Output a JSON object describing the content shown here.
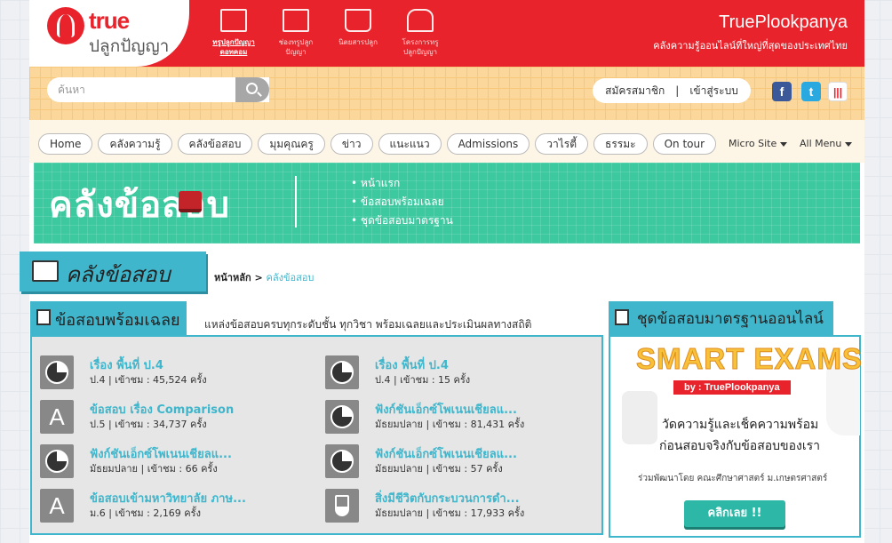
{
  "header": {
    "logo_word": "true",
    "logo_thai": "ปลูกปัญญา",
    "brand_title": "TruePlookpanya",
    "brand_subtitle": "คลังความรู้ออนไลน์ที่ใหญ่ที่สุดของประเทศไทย",
    "nav": [
      {
        "label_1": "ทรูปลูกปัญญา",
        "label_2": "ดอทคอม",
        "icon": "monitor-icon"
      },
      {
        "label_1": "ช่องทรูปลูก",
        "label_2": "ปัญญา",
        "icon": "tv-icon"
      },
      {
        "label_1": "นิตยสารปลูก",
        "label_2": "",
        "icon": "book-icon"
      },
      {
        "label_1": "โครงการทรู",
        "label_2": "ปลูกปัญญา",
        "icon": "school-icon"
      }
    ]
  },
  "search": {
    "placeholder": "ค้นหา",
    "register": "สมัครสมาชิก",
    "divider": "|",
    "login": "เข้าสู่ระบบ",
    "social": {
      "facebook": "f",
      "twitter": "t",
      "stats": "|||"
    }
  },
  "menu": {
    "items": [
      "Home",
      "คลังความรู้",
      "คลังข้อสอบ",
      "มุมคุณครู",
      "ข่าว",
      "แนะแนว",
      "Admissions",
      "วาไรตี้",
      "ธรรมะ",
      "On tour"
    ],
    "micro_site": "Micro Site",
    "all_menu": "All Menu"
  },
  "banner": {
    "title": "คลังข้อสอบ",
    "links": [
      "หน้าแรก",
      "ข้อสอบพร้อมเฉลย",
      "ชุดข้อสอบมาตรฐาน"
    ]
  },
  "section": {
    "title": "คลังข้อสอบ",
    "breadcrumb_home": "หน้าหลัก",
    "breadcrumb_sep": ">",
    "breadcrumb_current": "คลังข้อสอบ"
  },
  "exams": {
    "heading": "ข้อสอบพร้อมเฉลย",
    "description": "แหล่งข้อสอบครบทุกระดับชั้น ทุกวิชา พร้อมเฉลยและประเมินผลทางสถิติ",
    "items": [
      {
        "title": "เรื่อง พื้นที่ ป.4",
        "meta": "ป.4 | เข้าชม : 45,524 ครั้ง",
        "icon": "pie-icon"
      },
      {
        "title": "เรื่อง พื้นที่ ป.4",
        "meta": "ป.4 | เข้าชม : 15 ครั้ง",
        "icon": "pie-icon"
      },
      {
        "title": "ข้อสอบ เรื่อง Comparison",
        "meta": "ป.5 | เข้าชม : 34,737 ครั้ง",
        "icon": "letter-a-icon"
      },
      {
        "title": "ฟังก์ชันเอ็กซ์โพเนนเชียลแ...",
        "meta": "มัธยมปลาย | เข้าชม : 81,431 ครั้ง",
        "icon": "pie-icon"
      },
      {
        "title": "ฟังก์ชันเอ็กซ์โพเนนเชียลแ...",
        "meta": "มัธยมปลาย | เข้าชม : 66 ครั้ง",
        "icon": "pie-icon"
      },
      {
        "title": "ฟังก์ชันเอ็กซ์โพเนนเชียลแ...",
        "meta": "มัธยมปลาย | เข้าชม : 57 ครั้ง",
        "icon": "pie-icon"
      },
      {
        "title": "ข้อสอบเข้ามหาวิทยาลัย ภาษ...",
        "meta": "ม.6 | เข้าชม : 2,169 ครั้ง",
        "icon": "letter-a-icon"
      },
      {
        "title": "สิ่งมีชีวิตกับกระบวนการดำ...",
        "meta": "มัธยมปลาย | เข้าชม : 17,933 ครั้ง",
        "icon": "flask-icon"
      }
    ]
  },
  "standard": {
    "heading": "ชุดข้อสอบมาตรฐานออนไลน์",
    "promo_title": "SMART EXAMS",
    "promo_by": "by : TruePlookpanya",
    "line_1": "วัดความรู้และเช็คความพร้อม",
    "line_2": "ก่อนสอบจริงกับข้อสอบของเรา",
    "credit": "ร่วมพัฒนาโดย คณะศึกษาศาสตร์ ม.เกษตรศาสตร์",
    "button": "คลิกเลย !!"
  },
  "colors": {
    "brand_red": "#e8232b",
    "teal": "#3fb6cc",
    "green_banner": "#3dc9a0"
  }
}
